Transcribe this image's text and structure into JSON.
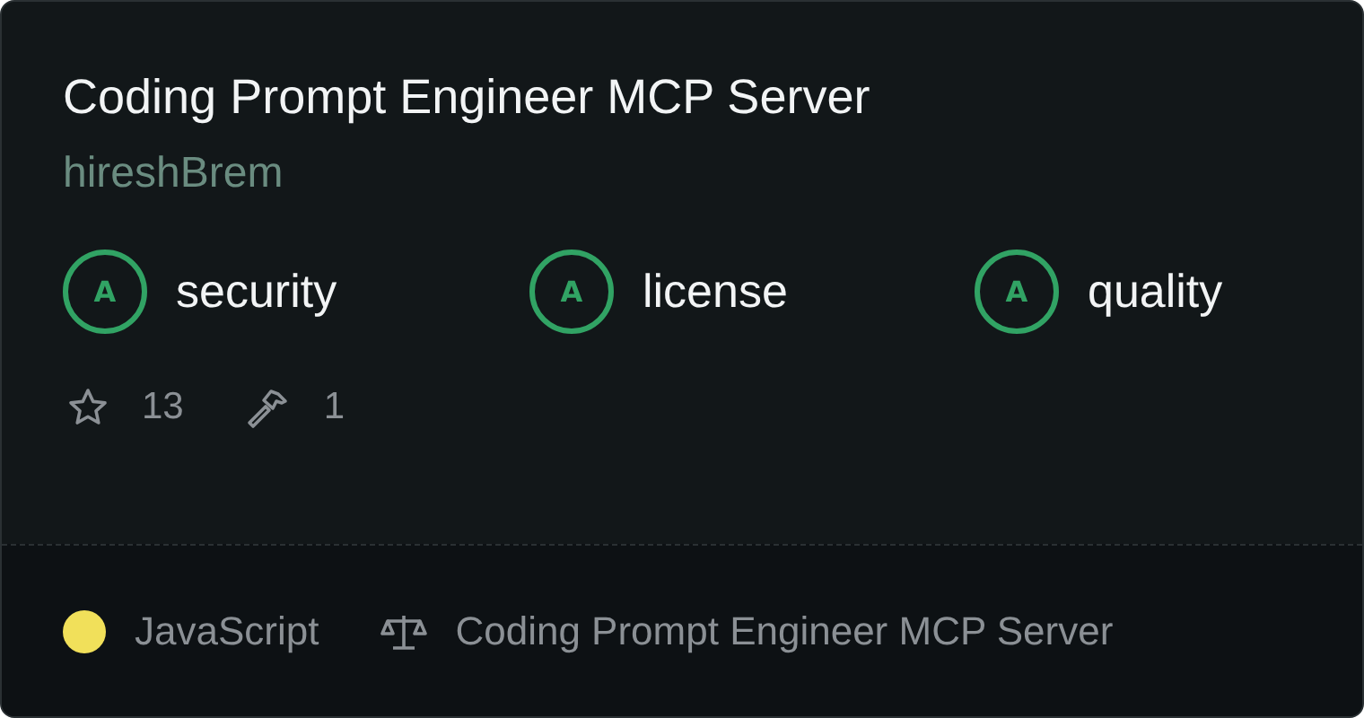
{
  "title": "Coding Prompt Engineer MCP Server",
  "author": "hireshBrem",
  "grades": [
    {
      "grade": "A",
      "label": "security"
    },
    {
      "grade": "A",
      "label": "license"
    },
    {
      "grade": "A",
      "label": "quality"
    }
  ],
  "stats": {
    "stars": "13",
    "tools": "1"
  },
  "footer": {
    "language": "JavaScript",
    "license": "Coding Prompt Engineer MCP Server"
  }
}
